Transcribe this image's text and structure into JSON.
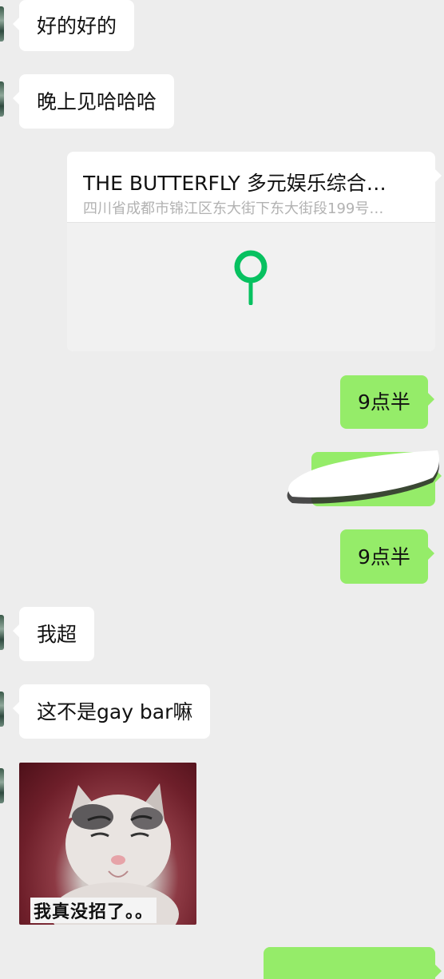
{
  "chat": {
    "messages": [
      {
        "side": "left",
        "type": "text",
        "text": "好的好的"
      },
      {
        "side": "left",
        "type": "text",
        "text": "晚上见哈哈哈"
      },
      {
        "side": "right",
        "type": "location",
        "title": "THE BUTTERFLY 多元娱乐综合…",
        "address": "四川省成都市锦江区东大街下东大街段199号…"
      },
      {
        "side": "right",
        "type": "text",
        "text": "9点半"
      },
      {
        "side": "right",
        "type": "redacted",
        "text": ""
      },
      {
        "side": "right",
        "type": "text",
        "text": "9点半"
      },
      {
        "side": "left",
        "type": "text",
        "text": "我超"
      },
      {
        "side": "left",
        "type": "text",
        "text": "这不是gay bar嘛"
      },
      {
        "side": "left",
        "type": "image",
        "caption": "我真没招了。。"
      }
    ]
  },
  "colors": {
    "background": "#ededed",
    "bubble_self": "#95ec69",
    "bubble_other": "#ffffff",
    "map_pin": "#07c160"
  },
  "icons": {
    "map_pin": "location-pin-icon"
  }
}
